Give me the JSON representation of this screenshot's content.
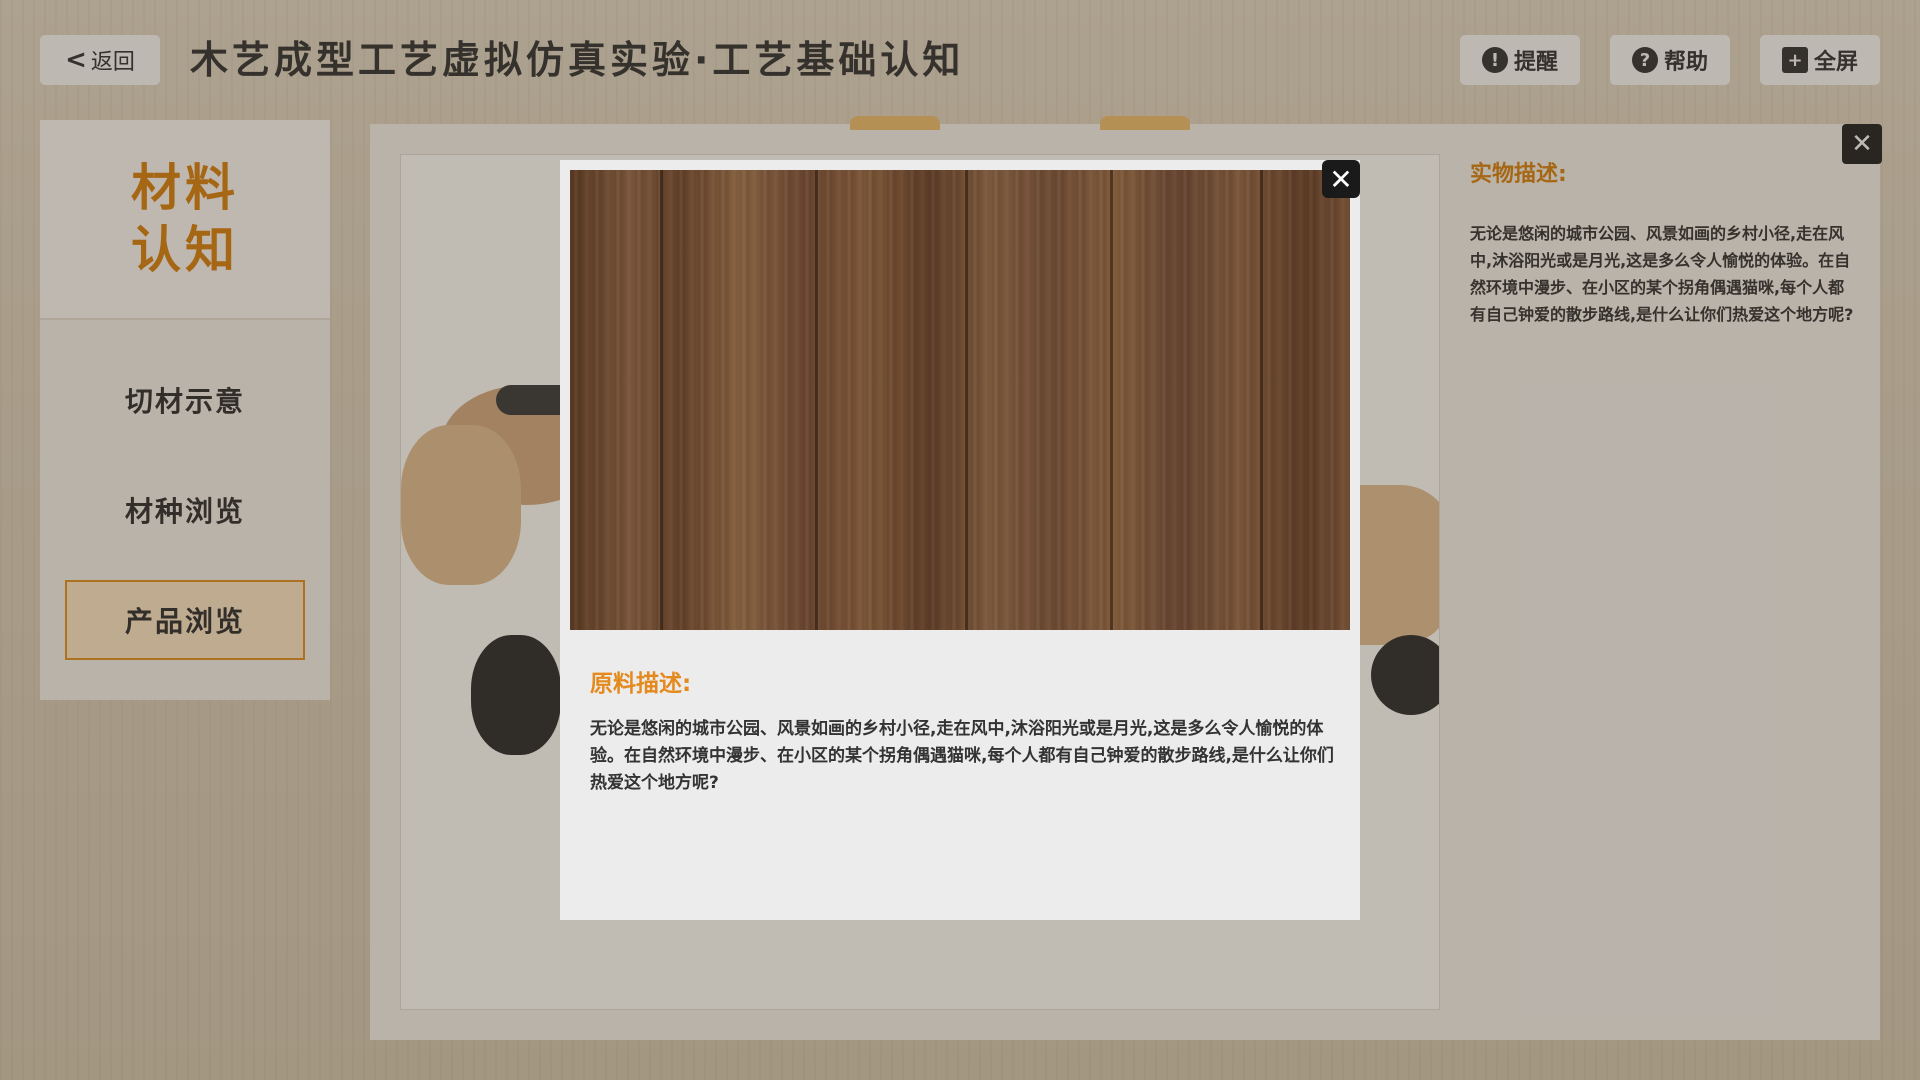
{
  "header": {
    "back_label": "返回",
    "title": "木艺成型工艺虚拟仿真实验·工艺基础认知",
    "buttons": [
      {
        "label": "提醒",
        "icon": "lightbulb-icon",
        "glyph": "💡"
      },
      {
        "label": "帮助",
        "icon": "help-icon",
        "glyph": "?"
      },
      {
        "label": "全屏",
        "icon": "fullscreen-icon",
        "glyph": "✚"
      }
    ]
  },
  "sidebar": {
    "heading_line1": "材料",
    "heading_line2": "认知",
    "items": [
      {
        "label": "切材示意",
        "active": false
      },
      {
        "label": "材种浏览",
        "active": false
      },
      {
        "label": "产品浏览",
        "active": true
      }
    ]
  },
  "detail": {
    "title": "实物描述:",
    "text": "无论是悠闲的城市公园、风景如画的乡村小径,走在风中,沐浴阳光或是月光,这是多么令人愉悦的体验。在自然环境中漫步、在小区的某个拐角偶遇猫咪,每个人都有自己钟爱的散步路线,是什么让你们热爱这个地方呢?"
  },
  "modal": {
    "subtitle": "原料描述:",
    "text": "无论是悠闲的城市公园、风景如画的乡村小径,走在风中,沐浴阳光或是月光,这是多么令人愉悦的体验。在自然环境中漫步、在小区的某个拐角偶遇猫咪,每个人都有自己钟爱的散步路线,是什么让你们热爱这个地方呢?",
    "close_glyph": "✕"
  },
  "main_close_glyph": "✕",
  "colors": {
    "accent": "#e48a1d",
    "heading_orange": "#cf7d12",
    "active_bg": "#f0dcbd"
  }
}
